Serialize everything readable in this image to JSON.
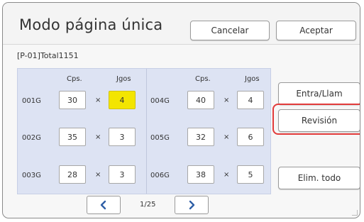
{
  "header": {
    "title": "Modo página única",
    "cancel_label": "Cancelar",
    "accept_label": "Aceptar"
  },
  "subline": "[P-01]Total1151",
  "grid": {
    "left": {
      "col_cps": "Cps.",
      "col_jgos": "Jgos",
      "rows": [
        {
          "label": "001G",
          "cps": "30",
          "jgos": "4",
          "selected": true
        },
        {
          "label": "002G",
          "cps": "35",
          "jgos": "3"
        },
        {
          "label": "003G",
          "cps": "28",
          "jgos": "3"
        }
      ]
    },
    "right": {
      "col_cps": "Cps.",
      "col_jgos": "Jgos",
      "rows": [
        {
          "label": "004G",
          "cps": "40",
          "jgos": "4"
        },
        {
          "label": "005G",
          "cps": "32",
          "jgos": "6"
        },
        {
          "label": "006G",
          "cps": "38",
          "jgos": "5"
        }
      ]
    },
    "times": "×"
  },
  "side": {
    "entra": "Entra/Llam",
    "revision": "Revisión",
    "elim": "Elim. todo"
  },
  "nav": {
    "page": "1/25",
    "prev_icon": "chevron-left-icon",
    "next_icon": "chevron-right-icon"
  },
  "colors": {
    "blue_panel": "#dde3f3",
    "selected_yellow": "#f3e500",
    "highlight_red": "#e23b3b",
    "chevron_blue": "#2f5fa6"
  }
}
